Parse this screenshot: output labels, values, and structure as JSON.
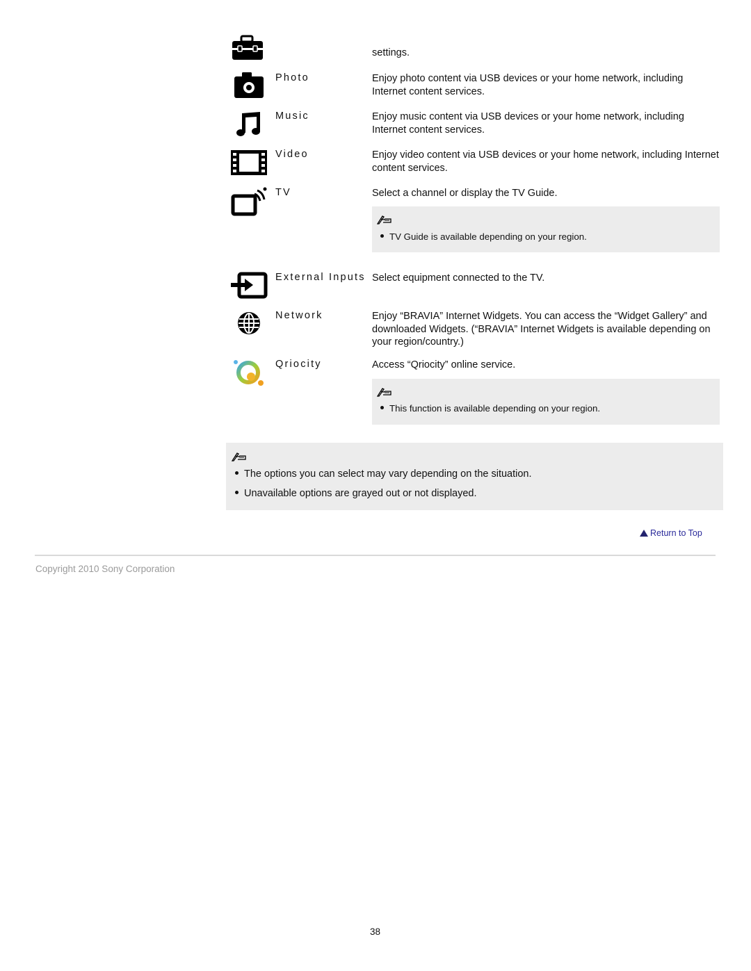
{
  "rows": [
    {
      "label": "",
      "icon": "toolbox-icon",
      "description": "settings."
    },
    {
      "label": "Photo",
      "icon": "camera-icon",
      "description": "Enjoy photo content via USB devices or your home network, including Internet content services."
    },
    {
      "label": "Music",
      "icon": "music-note-icon",
      "description": "Enjoy music content via USB devices or your home network, including Internet content services."
    },
    {
      "label": "Video",
      "icon": "film-strip-icon",
      "description": "Enjoy video content via USB devices or your home network, including Internet content services."
    },
    {
      "label": "TV",
      "icon": "tv-icon",
      "description": "Select a channel or display the TV Guide."
    },
    {
      "label": "External Inputs",
      "icon": "external-input-icon",
      "description": "Select equipment connected to the TV."
    },
    {
      "label": "Network",
      "icon": "globe-icon",
      "description": "Enjoy “BRAVIA” Internet Widgets. You can access the “Widget Gallery” and downloaded Widgets. (“BRAVIA” Internet Widgets is available depending on your region/country.)"
    },
    {
      "label": "Qriocity",
      "icon": "qriocity-logo-icon",
      "description": "Access “Qriocity” online service."
    }
  ],
  "notes": {
    "tv": {
      "icon": "note-pen-icon",
      "items": [
        "TV Guide is available depending on your region."
      ]
    },
    "qriocity": {
      "icon": "note-pen-icon",
      "items": [
        "This function is available depending on your region."
      ]
    },
    "general": {
      "icon": "note-pen-icon",
      "items": [
        "The options you can select may vary depending on the situation.",
        "Unavailable options are grayed out or not displayed."
      ]
    }
  },
  "return_to_top": {
    "label": "Return to Top",
    "icon": "up-triangle-icon"
  },
  "footer": {
    "copyright": "Copyright 2010 Sony Corporation"
  },
  "page_number": "38",
  "colors": {
    "note_bg": "#ececec",
    "link": "#2a2a9a",
    "footer_text": "#9a9a9a"
  }
}
